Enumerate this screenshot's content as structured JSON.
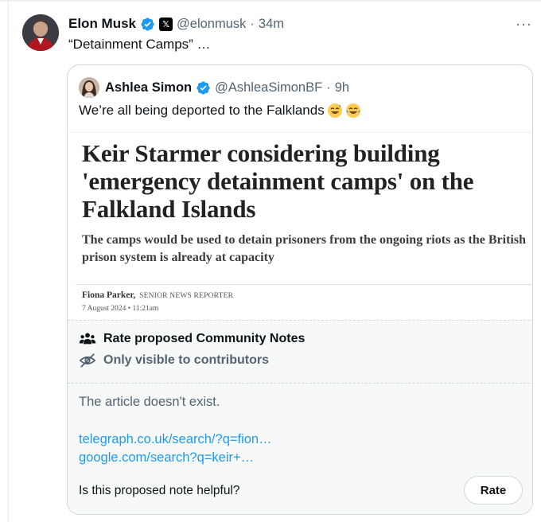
{
  "tweet": {
    "author_name": "Elon Musk",
    "author_handle": "@elonmusk",
    "separator": "·",
    "time": "34m",
    "text": "“Detainment Camps” …",
    "more_label": "···"
  },
  "quote": {
    "author_name": "Ashlea Simon",
    "author_handle": "@AshleaSimonBF",
    "separator": "·",
    "time": "9h",
    "text": "We’re all being deported to the Falklands",
    "emojis": [
      "sweat-smile-emoji",
      "tears-of-joy-emoji"
    ]
  },
  "article": {
    "headline": "Keir Starmer considering building 'emergency detainment camps' on the Falkland Islands",
    "subheadline": "The camps would be used to detain prisoners from the ongoing riots as the British prison system is already at capacity",
    "author": "Fiona Parker,",
    "author_role": "SENIOR NEWS REPORTER",
    "date": "7 August 2024 • 11:21am"
  },
  "community_notes": {
    "title": "Rate proposed Community Notes",
    "visibility": "Only visible to contributors",
    "note_text": "The article doesn't exist.",
    "links": [
      "telegraph.co.uk/search/?q=fion…",
      "google.com/search?q=keir+…"
    ],
    "question": "Is this proposed note helpful?",
    "rate_label": "Rate"
  },
  "colors": {
    "verified": "#1d9bf0",
    "link": "#1d9bf0",
    "secondary_text": "#536471",
    "notes_background": "#f7f9f9"
  }
}
